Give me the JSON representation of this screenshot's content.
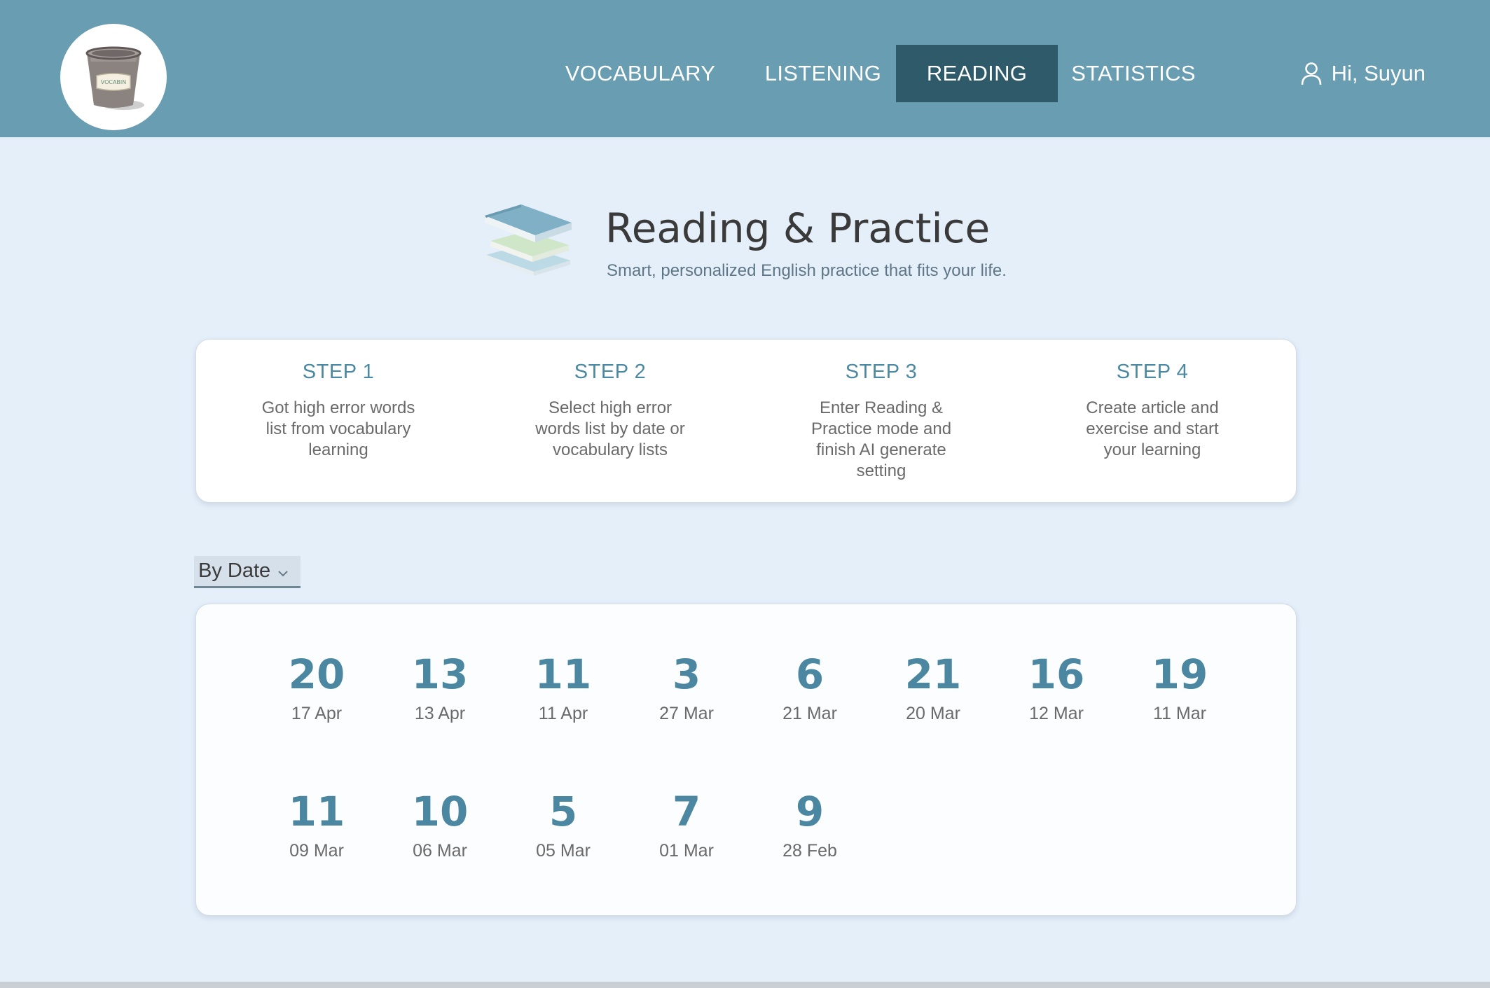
{
  "header": {
    "logo_text": "VOCABIN",
    "nav": [
      {
        "label": "VOCABULARY",
        "active": false
      },
      {
        "label": "LISTENING",
        "active": false
      },
      {
        "label": "READING",
        "active": true
      },
      {
        "label": "STATISTICS",
        "active": false
      }
    ],
    "greeting": "Hi, Suyun",
    "user_icon": "user-icon"
  },
  "hero": {
    "icon": "books-icon",
    "title": "Reading & Practice",
    "subtitle": "Smart, personalized English practice that fits your life."
  },
  "steps": [
    {
      "title": "STEP 1",
      "description": "Got high error words list from vocabulary learning"
    },
    {
      "title": "STEP 2",
      "description": "Select high error words list by date or vocabulary lists"
    },
    {
      "title": "STEP 3",
      "description": "Enter Reading & Practice mode and finish AI generate setting"
    },
    {
      "title": "STEP 4",
      "description": "Create article and exercise and start your learning"
    }
  ],
  "filter": {
    "selected": "By Date",
    "icon": "chevron-down-icon"
  },
  "dates": [
    {
      "count": "20",
      "date": "17 Apr"
    },
    {
      "count": "13",
      "date": "13 Apr"
    },
    {
      "count": "11",
      "date": "11 Apr"
    },
    {
      "count": "3",
      "date": "27 Mar"
    },
    {
      "count": "6",
      "date": "21 Mar"
    },
    {
      "count": "21",
      "date": "20 Mar"
    },
    {
      "count": "16",
      "date": "12 Mar"
    },
    {
      "count": "19",
      "date": "11 Mar"
    },
    {
      "count": "11",
      "date": "09 Mar"
    },
    {
      "count": "10",
      "date": "06 Mar"
    },
    {
      "count": "5",
      "date": "05 Mar"
    },
    {
      "count": "7",
      "date": "01 Mar"
    },
    {
      "count": "9",
      "date": "28 Feb"
    }
  ],
  "colors": {
    "header_bg": "#699db1",
    "nav_active_bg": "#2e5a69",
    "page_bg": "#e5effa",
    "accent_text": "#4b87a1"
  }
}
